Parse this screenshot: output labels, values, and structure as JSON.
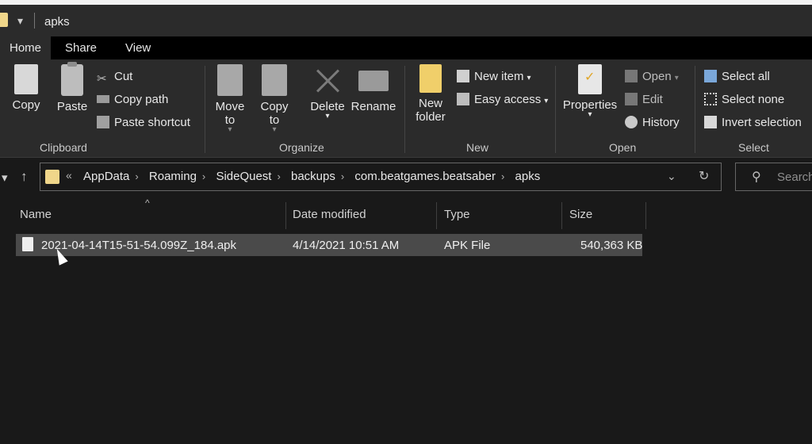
{
  "window": {
    "title": "apks"
  },
  "tabs": [
    {
      "label": "Home",
      "active": true
    },
    {
      "label": "Share",
      "active": false
    },
    {
      "label": "View",
      "active": false
    }
  ],
  "ribbon": {
    "clipboard": {
      "label": "Clipboard",
      "copy": "Copy",
      "paste": "Paste",
      "cut": "Cut",
      "copy_path": "Copy path",
      "paste_shortcut": "Paste shortcut"
    },
    "organize": {
      "label": "Organize",
      "move_to": "Move to",
      "copy_to": "Copy to",
      "delete": "Delete",
      "rename": "Rename"
    },
    "new": {
      "label": "New",
      "new_folder": "New folder",
      "new_item": "New item",
      "easy_access": "Easy access"
    },
    "open": {
      "label": "Open",
      "properties": "Properties",
      "open": "Open",
      "edit": "Edit",
      "history": "History"
    },
    "select": {
      "label": "Select",
      "select_all": "Select all",
      "select_none": "Select none",
      "invert_selection": "Invert selection"
    }
  },
  "address": {
    "overflow": "«",
    "crumbs": [
      "AppData",
      "Roaming",
      "SideQuest",
      "backups",
      "com.beatgames.beatsaber",
      "apks"
    ]
  },
  "search": {
    "placeholder": "Search"
  },
  "columns": {
    "name": "Name",
    "date_modified": "Date modified",
    "type": "Type",
    "size": "Size"
  },
  "files": [
    {
      "name": "2021-04-14T15-51-54.099Z_184.apk",
      "date_modified": "4/14/2021 10:51 AM",
      "type": "APK File",
      "size": "540,363 KB",
      "selected": true
    }
  ],
  "colors": {
    "background": "#191919",
    "ribbon": "#2b2b2b",
    "selection": "#4a4a4a",
    "folder": "#f0d68a"
  }
}
